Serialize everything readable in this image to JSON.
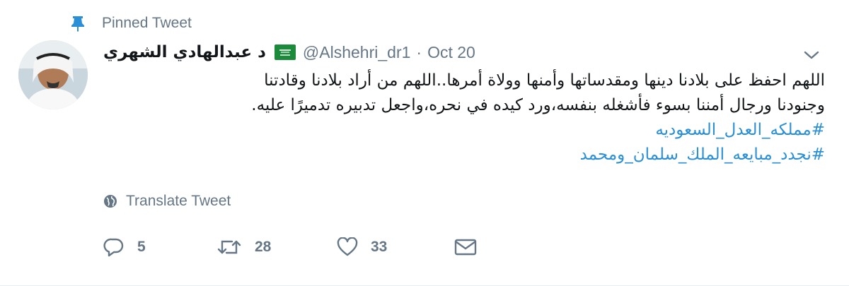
{
  "pinned": {
    "label": "Pinned Tweet",
    "icon": "pin-icon"
  },
  "author": {
    "display_name": "د عبدالهادي الشهري",
    "flag": "saudi-flag-icon",
    "handle": "@Alshehri_dr1",
    "separator": "·",
    "date": "Oct 20"
  },
  "tweet": {
    "lines": [
      "اللهم احفظ على بلادنا دينها ومقدساتها وأمنها وولاة أمرها..اللهم من أراد بلادنا وقادتنا",
      "وجنودنا ورجال أمننا بسوء فأشغله بنفسه،ورد كيده في نحره،واجعل تدبيره تدميرًا عليه."
    ],
    "hashtags": [
      "#مملكه_العدل_السعوديه",
      "#نجدد_مبايعه_الملك_سلمان_ومحمد"
    ]
  },
  "translate": {
    "label": "Translate Tweet",
    "icon": "globe-icon"
  },
  "actions": {
    "reply": {
      "icon": "reply-icon",
      "count": "5"
    },
    "retweet": {
      "icon": "retweet-icon",
      "count": "28"
    },
    "like": {
      "icon": "heart-icon",
      "count": "33"
    },
    "dm": {
      "icon": "envelope-icon"
    }
  },
  "colors": {
    "link": "#2a8fd6",
    "muted": "#657786",
    "pin": "#2a8fd6",
    "text": "#14171a"
  }
}
